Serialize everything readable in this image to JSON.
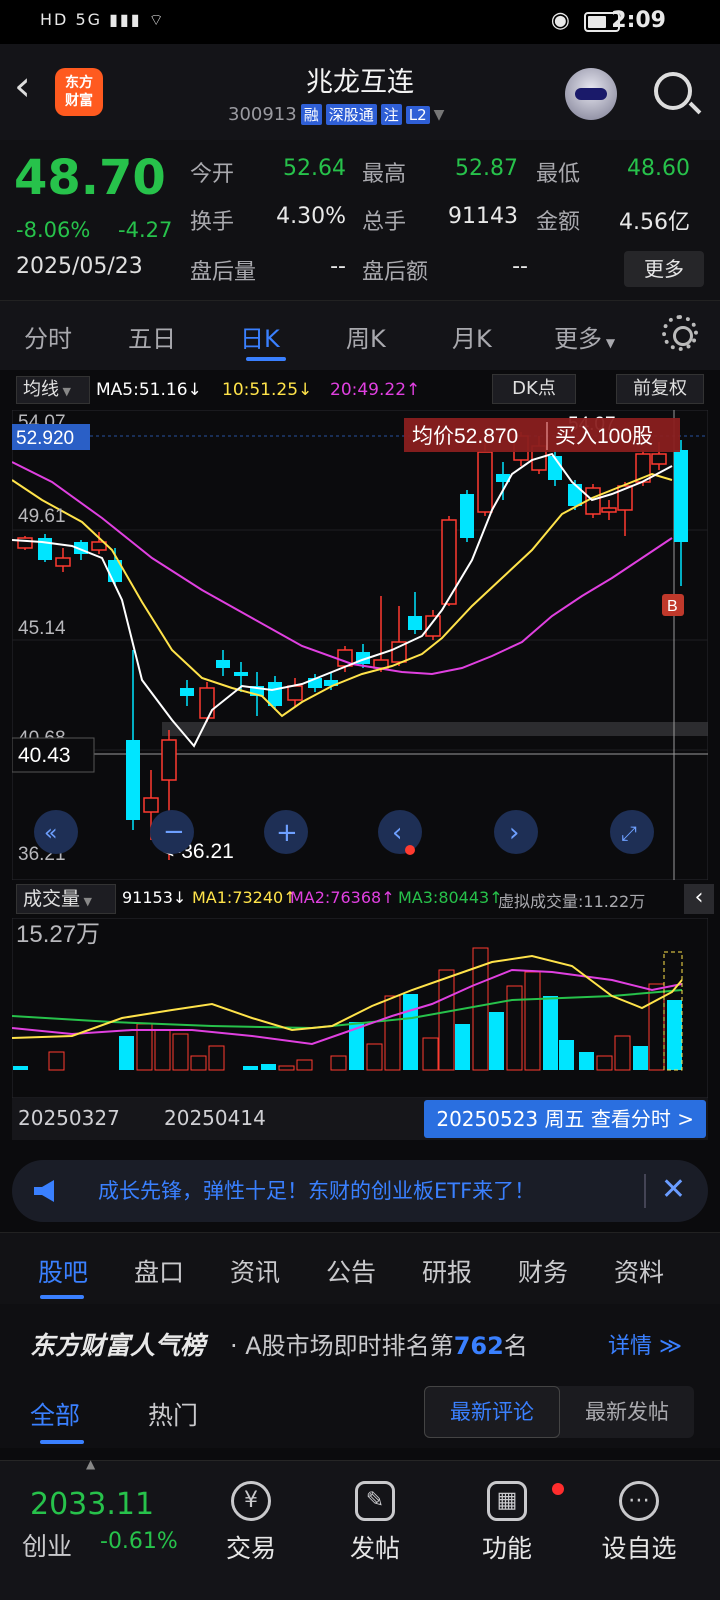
{
  "status": {
    "left": "HD 5G ▮▮▮ ⌔",
    "time": "2:09"
  },
  "header": {
    "title": "兆龙互连",
    "code": "300913",
    "tags": [
      "融",
      "深股通",
      "注",
      "L2"
    ],
    "logo": "东方\n财富"
  },
  "quote": {
    "price": "48.70",
    "chg_pct": "-8.06%",
    "chg_abs": "-4.27",
    "date": "2025/05/23",
    "fields": [
      {
        "label": "今开",
        "value": "52.64",
        "color": "#27c24b"
      },
      {
        "label": "最高",
        "value": "52.87",
        "color": "#27c24b"
      },
      {
        "label": "最低",
        "value": "48.60",
        "color": "#27c24b"
      },
      {
        "label": "换手",
        "value": "4.30%",
        "color": "#e8e8e8"
      },
      {
        "label": "总手",
        "value": "91143",
        "color": "#e8e8e8"
      },
      {
        "label": "金额",
        "value": "4.56亿",
        "color": "#e8e8e8"
      },
      {
        "label": "盘后量",
        "value": "--",
        "color": "#e8e8e8"
      },
      {
        "label": "盘后额",
        "value": "--",
        "color": "#e8e8e8"
      }
    ],
    "more": "更多"
  },
  "tabs": [
    "分时",
    "五日",
    "日K",
    "周K",
    "月K",
    "更多"
  ],
  "ma_bar": {
    "label": "均线",
    "ma5": "MA5:51.16↓",
    "ma10": "10:51.25↓",
    "ma20": "20:49.22↑",
    "dk": "DK点",
    "fq": "前复权"
  },
  "kline": {
    "y_labels": [
      "54.07",
      "52.920",
      "49.61",
      "45.14",
      "40.68",
      "40.43",
      "36.21"
    ],
    "tooltip_avg": "均价52.870",
    "tooltip_buy": "买入100股",
    "high_mark": "54.07",
    "low_mark": "<-36.21",
    "b_mark": "B"
  },
  "vol_bar": {
    "label": "成交量",
    "v": "91153↓",
    "ma1": "MA1:73240↑",
    "ma2": "MA2:76368↑",
    "ma3": "MA3:80443↑",
    "virtual": "虚拟成交量:11.22万"
  },
  "vol_max": "15.27万",
  "dates": {
    "d1": "20250327",
    "d2": "20250414",
    "btn": "20250523 周五 查看分时 >"
  },
  "ad": {
    "text": "成长先锋，弹性十足！东财的创业板ETF来了！"
  },
  "sections": [
    "股吧",
    "盘口",
    "资讯",
    "公告",
    "研报",
    "财务",
    "资料"
  ],
  "rank": {
    "brand": "东方财富人气榜",
    "pre": "· A股市场即时排名第",
    "num": "762",
    "post": "名",
    "more": "详情 ≫"
  },
  "sub": {
    "all": "全部",
    "hot": "热门",
    "newest_comment": "最新评论",
    "newest_post": "最新发帖"
  },
  "bottom": {
    "index_value": "2033.11",
    "index_name": "创业",
    "index_chg": "-0.61%",
    "nav": [
      "交易",
      "发帖",
      "功能",
      "设自选"
    ]
  },
  "colors": {
    "up": "#ff3b30",
    "down": "#00e5ff",
    "green": "#27c24b",
    "accent": "#3a80ff"
  }
}
